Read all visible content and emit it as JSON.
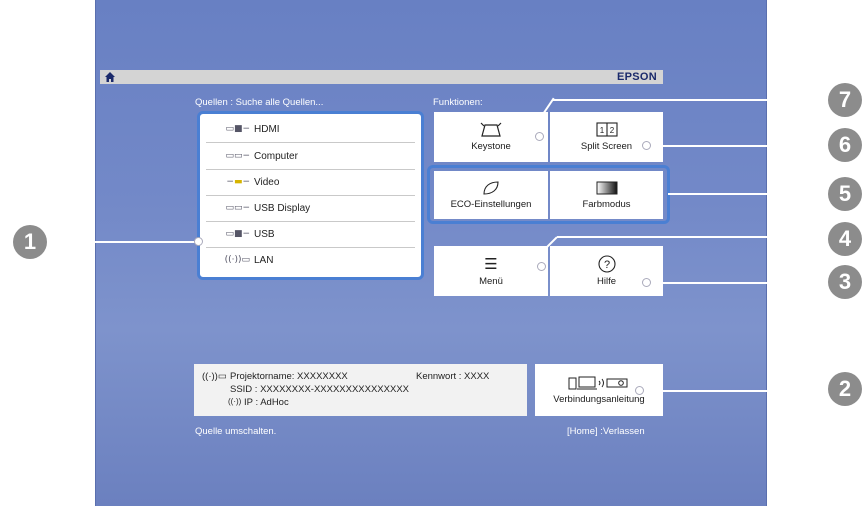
{
  "header": {
    "brand": "EPSON",
    "home_icon": "home-icon"
  },
  "sources": {
    "title": "Quellen :  Suche alle Quellen...",
    "items": [
      {
        "label": "HDMI",
        "icon": "hdmi-icon"
      },
      {
        "label": "Computer",
        "icon": "computer-icon"
      },
      {
        "label": "Video",
        "icon": "video-icon"
      },
      {
        "label": "USB Display",
        "icon": "usb-display-icon"
      },
      {
        "label": "USB",
        "icon": "usb-icon"
      },
      {
        "label": "LAN",
        "icon": "lan-icon"
      }
    ]
  },
  "functions": {
    "title": "Funktionen:",
    "buttons": {
      "keystone": "Keystone",
      "split_screen": "Split Screen",
      "eco": "ECO-Einstellungen",
      "color_mode": "Farbmodus",
      "menu": "Menü",
      "help": "Hilfe"
    }
  },
  "network": {
    "projector_name": "Projektorname:  XXXXXXXX",
    "password": "Kennwort :  XXXX",
    "ssid": "SSID :  XXXXXXXX-XXXXXXXXXXXXXXX",
    "ip": "IP :  AdHoc",
    "guide_button": "Verbindungsanleitung"
  },
  "status": {
    "left": "Quelle umschalten.",
    "right": "[Home] :Verlassen"
  },
  "callouts": [
    "1",
    "2",
    "3",
    "4",
    "5",
    "6",
    "7"
  ]
}
